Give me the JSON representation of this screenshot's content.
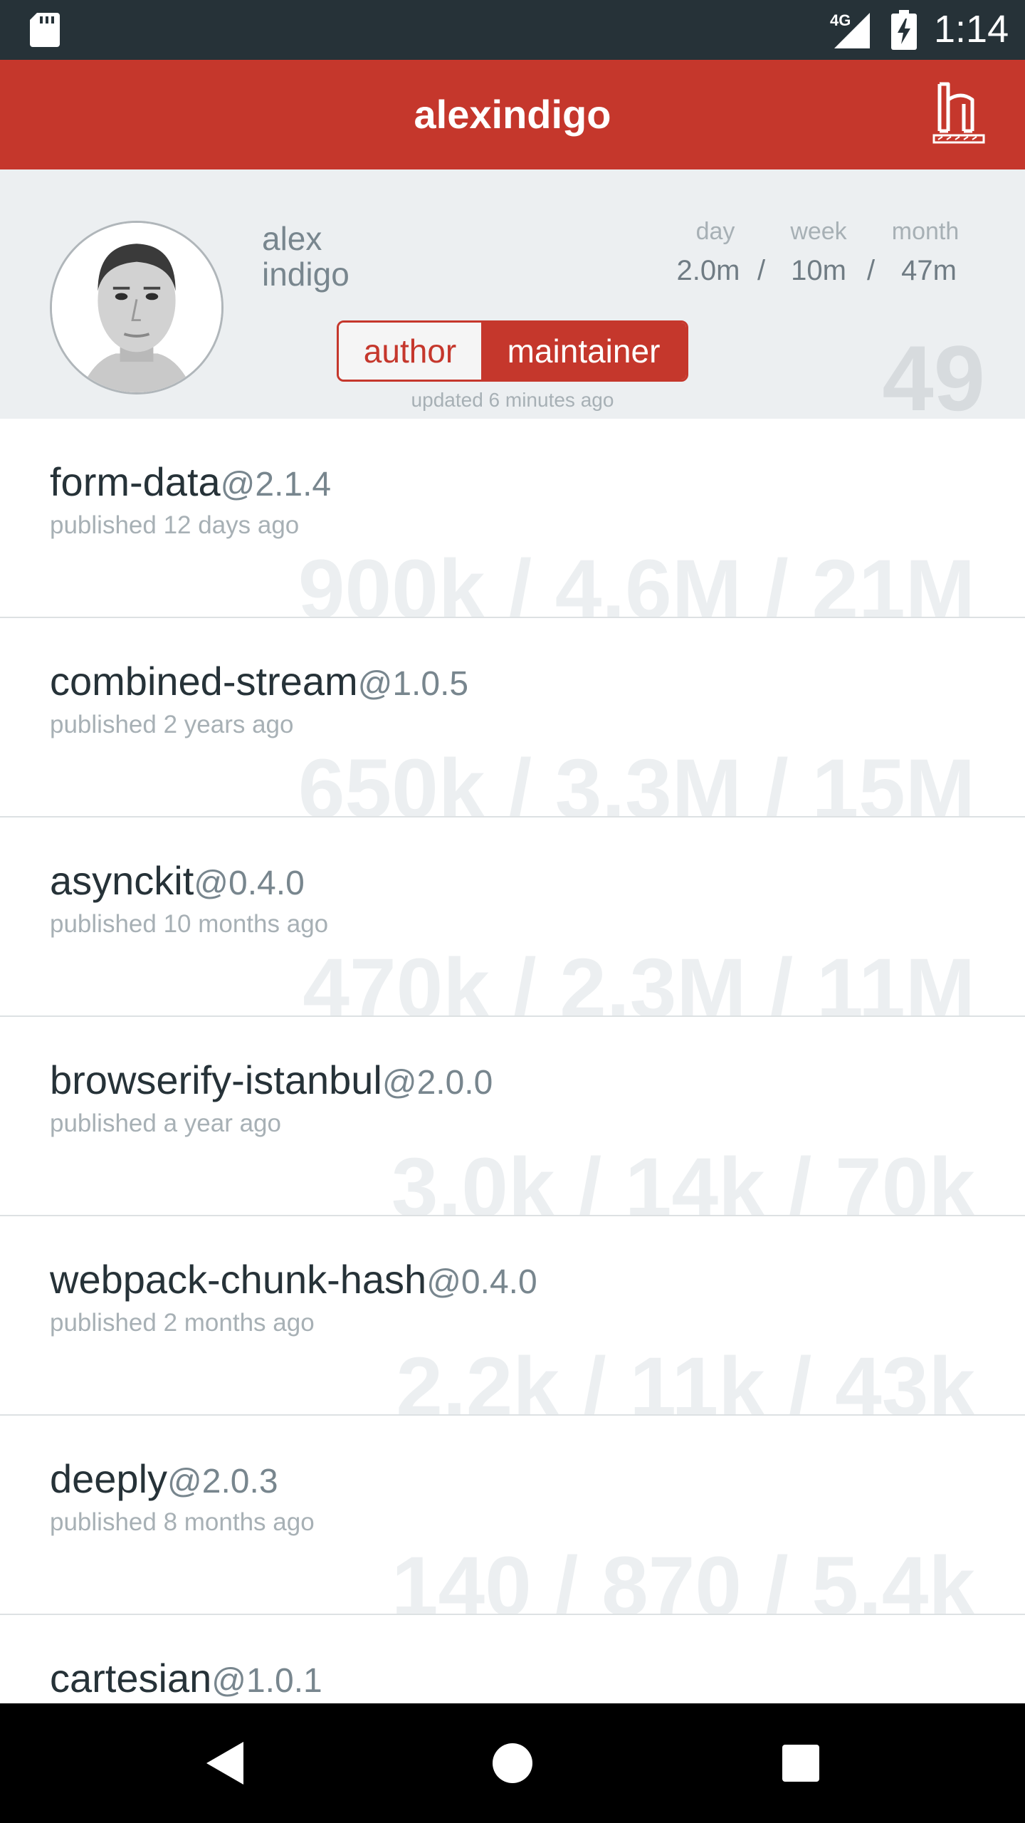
{
  "status_bar": {
    "network": "4G",
    "time": "1:14"
  },
  "app_bar": {
    "title": "alexindigo"
  },
  "profile": {
    "first_name": "alex",
    "last_name": "indigo",
    "stats": {
      "day_label": "day",
      "week_label": "week",
      "month_label": "month",
      "day_value": "2.0m",
      "week_value": "10m",
      "month_value": "47m",
      "separator": "/"
    },
    "role_toggle": {
      "author_label": "author",
      "maintainer_label": "maintainer",
      "selected": "maintainer"
    },
    "updated_text": "updated 6 minutes ago",
    "package_count": "49"
  },
  "packages": [
    {
      "name": "form-data",
      "version": "@2.1.4",
      "published": "published 12 days ago",
      "downloads": "900k / 4.6M / 21M"
    },
    {
      "name": "combined-stream",
      "version": "@1.0.5",
      "published": "published 2 years ago",
      "downloads": "650k / 3.3M / 15M"
    },
    {
      "name": "asynckit",
      "version": "@0.4.0",
      "published": "published 10 months ago",
      "downloads": "470k / 2.3M / 11M"
    },
    {
      "name": "browserify-istanbul",
      "version": "@2.0.0",
      "published": "published a year ago",
      "downloads": "3.0k / 14k / 70k"
    },
    {
      "name": "webpack-chunk-hash",
      "version": "@0.4.0",
      "published": "published 2 months ago",
      "downloads": "2.2k / 11k / 43k"
    },
    {
      "name": "deeply",
      "version": "@2.0.3",
      "published": "published 8 months ago",
      "downloads": "140 / 870 / 5.4k"
    },
    {
      "name": "cartesian",
      "version": "@1.0.1",
      "published": "",
      "downloads": ""
    }
  ],
  "colors": {
    "accent": "#c5372c",
    "status_bar": "#263238",
    "header_bg": "#eceff1"
  },
  "icons": {
    "sd_card": "sd-card-icon",
    "signal": "signal-icon",
    "battery": "battery-charging-icon",
    "logo": "npm-logo-icon",
    "back": "back-icon",
    "home": "home-icon",
    "recents": "recents-icon"
  }
}
